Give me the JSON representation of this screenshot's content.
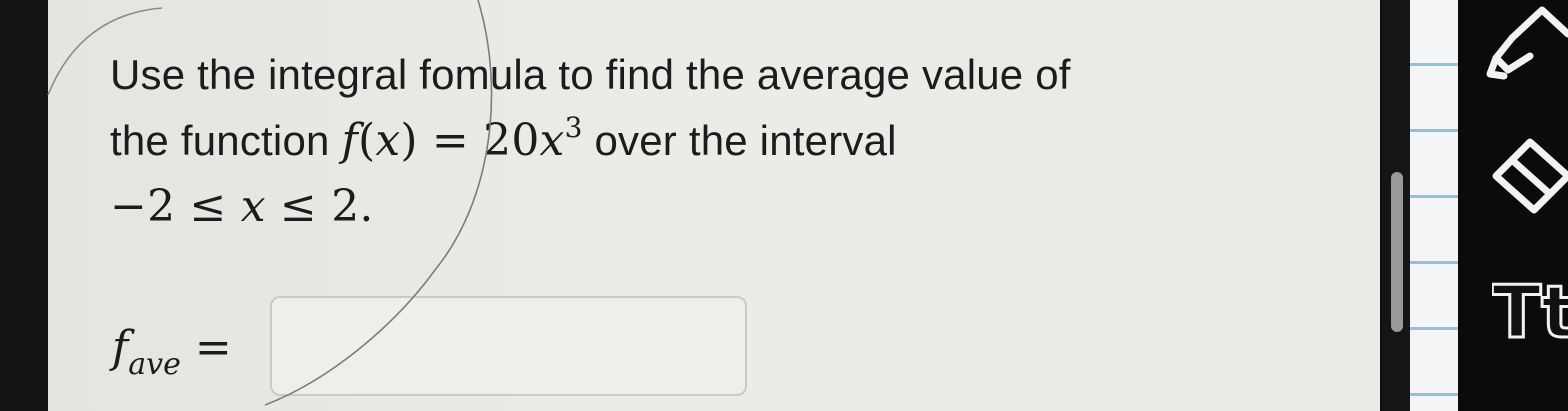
{
  "question": {
    "line1": "Use the integral fomula to find the average value of",
    "line2_prefix": "the function ",
    "func_name": "f",
    "func_var": "x",
    "func_equals": " = ",
    "func_coeff": "20",
    "func_power_var": "x",
    "func_exponent": "3",
    "line2_suffix": " over the interval",
    "interval_low": "−2",
    "interval_le": " ≤ ",
    "interval_var": "x",
    "interval_high": "2",
    "interval_end": "."
  },
  "answer": {
    "label_f": "f",
    "label_sub": "ave",
    "label_eq": "=",
    "value": ""
  },
  "toolbar": {
    "highlighter_icon": "highlighter-icon",
    "eraser_icon": "eraser-icon",
    "text_tool_label": "Tt"
  },
  "colors": {
    "paper": "#ebeae6",
    "text": "#1c1c1c",
    "toolbar": "#0b0b0b",
    "ruled_line": "#8fc3dc"
  }
}
